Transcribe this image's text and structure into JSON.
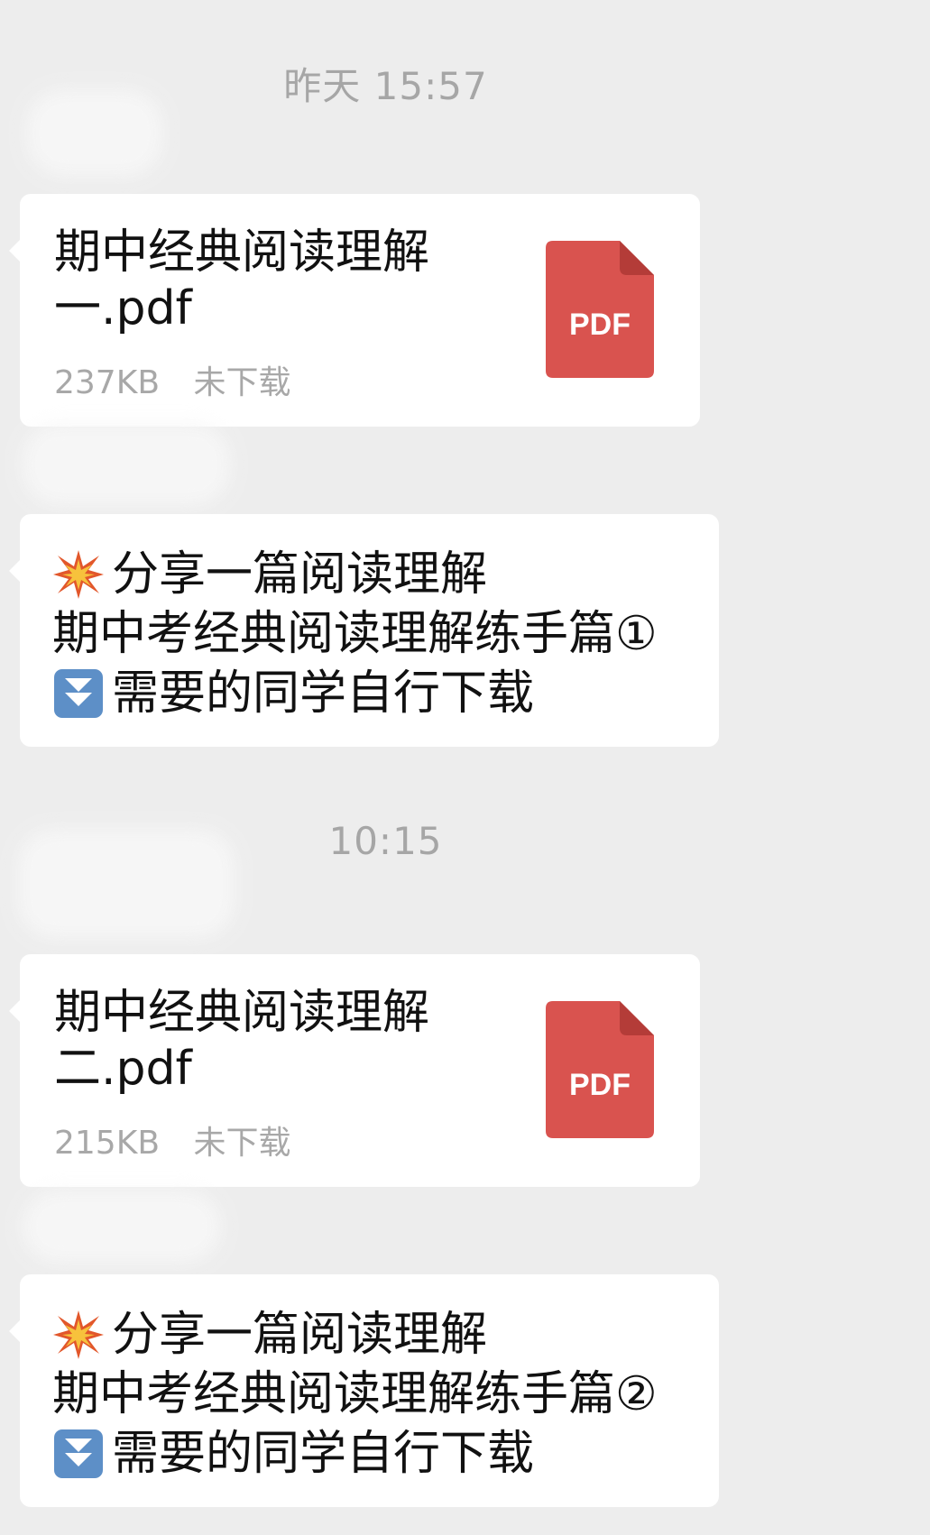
{
  "chat": {
    "time_1": "昨天 15:57",
    "time_2": "10:15",
    "messages": [
      {
        "type": "file",
        "name_line1": "期中经典阅读理解",
        "name_line2": "一.pdf",
        "size": "237KB",
        "status": "未下载",
        "icon": "pdf-icon",
        "icon_label": "PDF",
        "icon_color": "#d9534f"
      },
      {
        "type": "text",
        "line1_icon": "collision-emoji",
        "line1": "分享一篇阅读理解",
        "line2": "期中考经典阅读理解练手篇①",
        "line3_icon": "down-arrow-emoji",
        "line3": "需要的同学自行下载"
      },
      {
        "type": "file",
        "name_line1": "期中经典阅读理解",
        "name_line2": "二.pdf",
        "size": "215KB",
        "status": "未下载",
        "icon": "pdf-icon",
        "icon_label": "PDF",
        "icon_color": "#d9534f"
      },
      {
        "type": "text",
        "line1_icon": "collision-emoji",
        "line1": "分享一篇阅读理解",
        "line2": "期中考经典阅读理解练手篇②",
        "line3_icon": "down-arrow-emoji",
        "line3": "需要的同学自行下载"
      }
    ]
  }
}
